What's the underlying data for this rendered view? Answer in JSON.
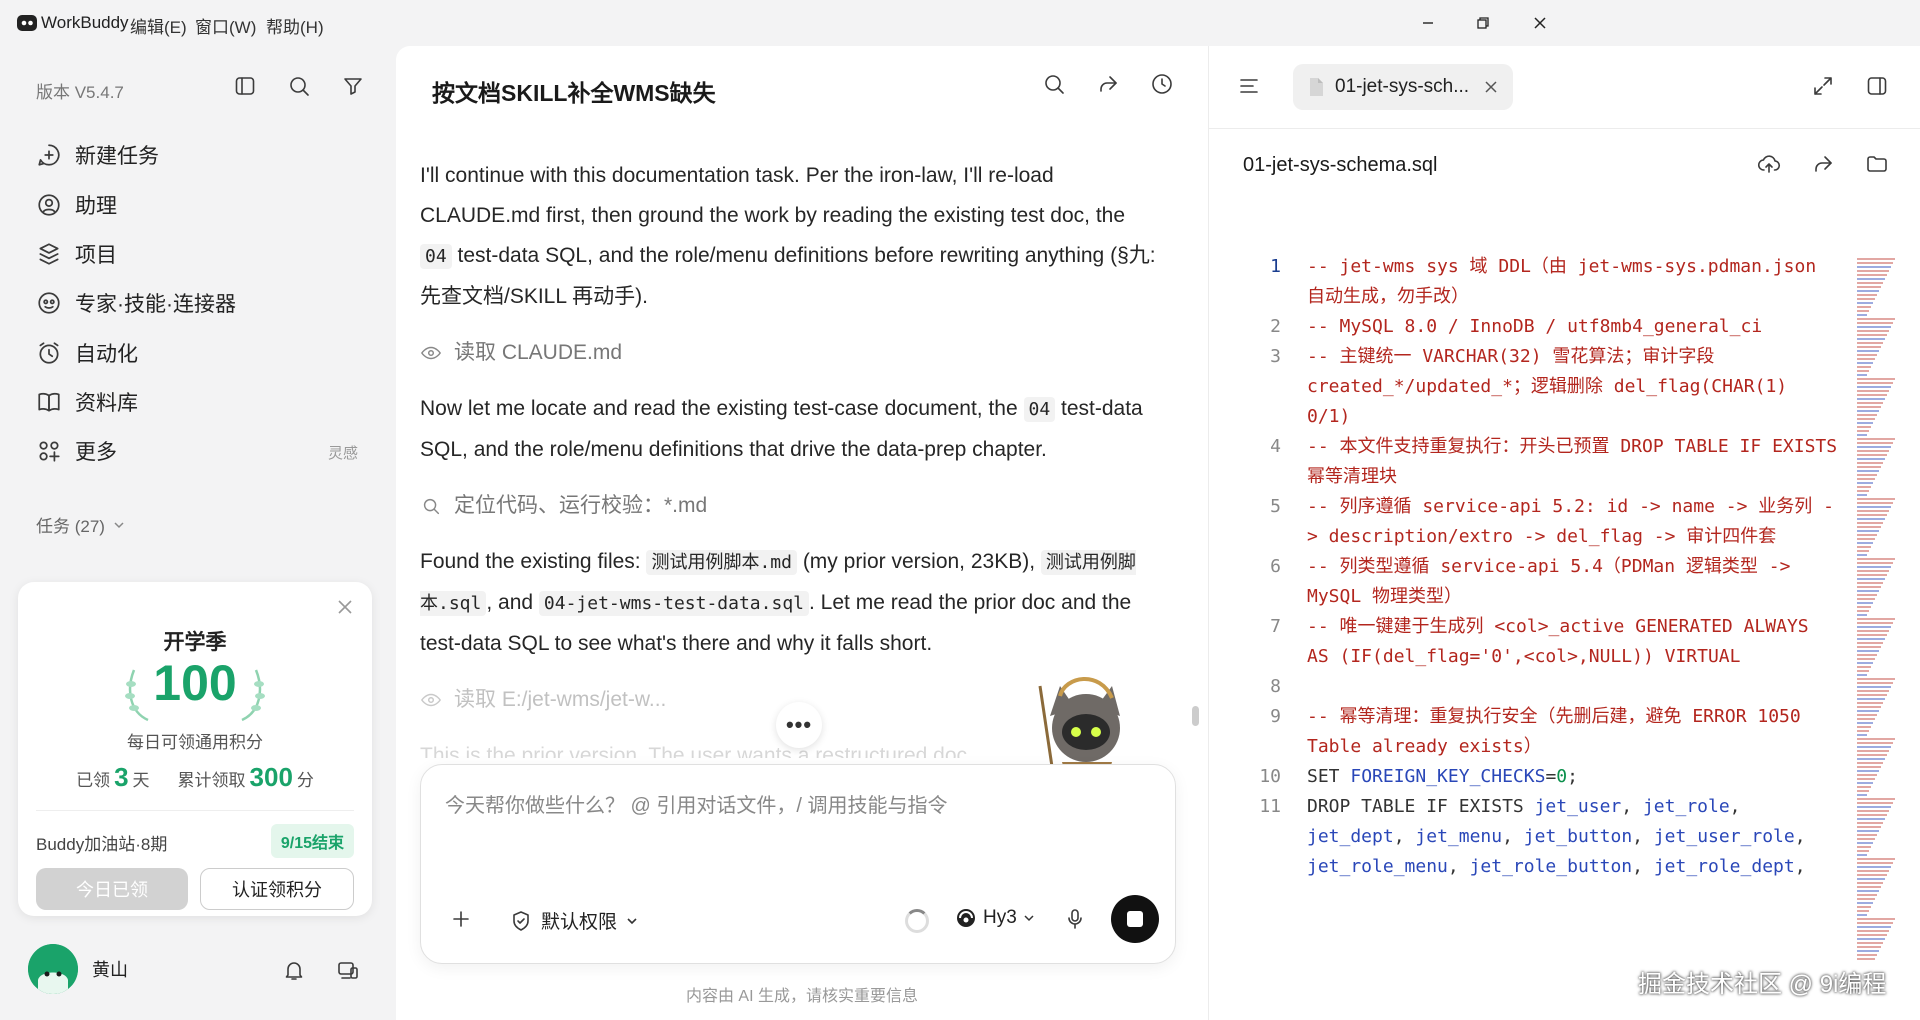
{
  "app": {
    "name": "WorkBuddy",
    "menus": [
      "编辑(E)",
      "窗口(W)",
      "帮助(H)"
    ]
  },
  "sidebar": {
    "version": "版本 V5.4.7",
    "nav": [
      {
        "label": "新建任务",
        "icon": "new-task-icon"
      },
      {
        "label": "助理",
        "icon": "assistant-icon"
      },
      {
        "label": "项目",
        "icon": "project-icon"
      },
      {
        "label": "专家·技能·连接器",
        "icon": "expert-icon"
      },
      {
        "label": "自动化",
        "icon": "automation-icon"
      },
      {
        "label": "资料库",
        "icon": "library-icon"
      },
      {
        "label": "更多",
        "icon": "more-apps-icon"
      }
    ],
    "more_extra": "灵感",
    "tasks_label": "任务 (27)"
  },
  "promo": {
    "title": "开学季",
    "score": "100",
    "subtitle": "每日可领通用积分",
    "claimed_prefix": "已领",
    "claimed_days": "3",
    "claimed_suffix": "天",
    "total_prefix": "累计领取",
    "total_points": "300",
    "total_suffix": "分",
    "period": "Buddy加油站·8期",
    "end_badge": "9/15结束",
    "btn_claimed": "今日已领",
    "btn_verify": "认证领积分"
  },
  "user": {
    "name": "黄山"
  },
  "chat": {
    "title": "按文档SKILL补全WMS缺失",
    "msg1": [
      "I'll continue with this documentation task. Per the iron-law, I'll re-load CLAUDE.md first, then ground the work by reading the existing test doc, the ",
      "04",
      " test-data SQL, and the role/menu definitions before rewriting anything (§九: 先查文档/SKILL 再动手)."
    ],
    "tool1": "读取 CLAUDE.md",
    "msg2": [
      "Now let me locate and read the existing test-case document, the ",
      "04",
      " test-data SQL, and the role/menu definitions that drive the data-prep chapter."
    ],
    "tool2": "定位代码、运行校验：*.md",
    "msg3": [
      "Found the existing files: ",
      "测试用例脚本.md",
      " (my prior version, 23KB), ",
      "测试用例脚本.sql",
      ", and ",
      "04-jet-wms-test-data.sql",
      ". Let me read the prior doc and the test-data SQL to see what's there and why it falls short."
    ],
    "tool3": "读取 E:/jet-wms/jet-w...",
    "faded_line": "This is the prior version. The user wants a restructured doc..."
  },
  "composer": {
    "placeholder": "今天帮你做些什么？ @ 引用对话文件，/ 调用技能与指令",
    "permission": "默认权限",
    "model": "Hy3",
    "footnote": "内容由 AI 生成，请核实重要信息"
  },
  "editor": {
    "tab_name": "01-jet-sys-sch...",
    "file_name": "01-jet-sys-schema.sql",
    "lines": [
      {
        "n": "1",
        "segs": [
          [
            "cm",
            "-- jet-wms sys 域 DDL（由 jet-wms-sys.pdman.json 自动生成，勿手改）"
          ]
        ]
      },
      {
        "n": "2",
        "segs": [
          [
            "cm",
            "-- MySQL 8.0 / InnoDB / utf8mb4_general_ci"
          ]
        ]
      },
      {
        "n": "3",
        "segs": [
          [
            "cm",
            "-- 主键统一 VARCHAR(32) 雪花算法；审计字段 created_*/updated_*；逻辑删除 del_flag(CHAR(1) 0/1)"
          ]
        ]
      },
      {
        "n": "4",
        "segs": [
          [
            "cm",
            "-- 本文件支持重复执行：开头已预置 DROP TABLE IF EXISTS 幂等清理块"
          ]
        ]
      },
      {
        "n": "5",
        "segs": [
          [
            "cm",
            "-- 列序遵循 service-api 5.2: id -> name -> 业务列 -> description/extro -> del_flag -> 审计四件套"
          ]
        ]
      },
      {
        "n": "6",
        "segs": [
          [
            "cm",
            "-- 列类型遵循 service-api 5.4（PDMan 逻辑类型 -> MySQL 物理类型）"
          ]
        ]
      },
      {
        "n": "7",
        "segs": [
          [
            "cm",
            "-- 唯一键建于生成列 <col>_active GENERATED ALWAYS AS (IF(del_flag='0',<col>,NULL)) VIRTUAL"
          ]
        ]
      },
      {
        "n": "8",
        "segs": [
          [
            "kw",
            " "
          ]
        ]
      },
      {
        "n": "9",
        "segs": [
          [
            "cm",
            "-- 幂等清理：重复执行安全（先删后建，避免 ERROR 1050 Table already exists）"
          ]
        ]
      },
      {
        "n": "10",
        "segs": [
          [
            "kw",
            "SET "
          ],
          [
            "id",
            "FOREIGN_KEY_CHECKS"
          ],
          [
            "kw",
            "="
          ],
          [
            "nm",
            "0"
          ],
          [
            "kw",
            ";"
          ]
        ]
      },
      {
        "n": "11",
        "segs": [
          [
            "kw",
            "DROP TABLE IF EXISTS "
          ],
          [
            "id",
            "jet_user"
          ],
          [
            "kw",
            ", "
          ],
          [
            "id",
            "jet_role"
          ],
          [
            "kw",
            ", "
          ],
          [
            "id",
            "jet_dept"
          ],
          [
            "kw",
            ", "
          ],
          [
            "id",
            "jet_menu"
          ],
          [
            "kw",
            ", "
          ],
          [
            "id",
            "jet_button"
          ],
          [
            "kw",
            ", "
          ],
          [
            "id",
            "jet_user_role"
          ],
          [
            "kw",
            ", "
          ],
          [
            "id",
            "jet_role_menu"
          ],
          [
            "kw",
            ", "
          ],
          [
            "id",
            "jet_role_button"
          ],
          [
            "kw",
            ", "
          ],
          [
            "id",
            "jet_role_dept"
          ],
          [
            "kw",
            ","
          ]
        ]
      }
    ]
  },
  "watermark": "掘金技术社区 @ 9i编程",
  "colors": {
    "accent": "#1aa36a",
    "comment": "#b3261e",
    "identifier": "#2a47b8"
  }
}
